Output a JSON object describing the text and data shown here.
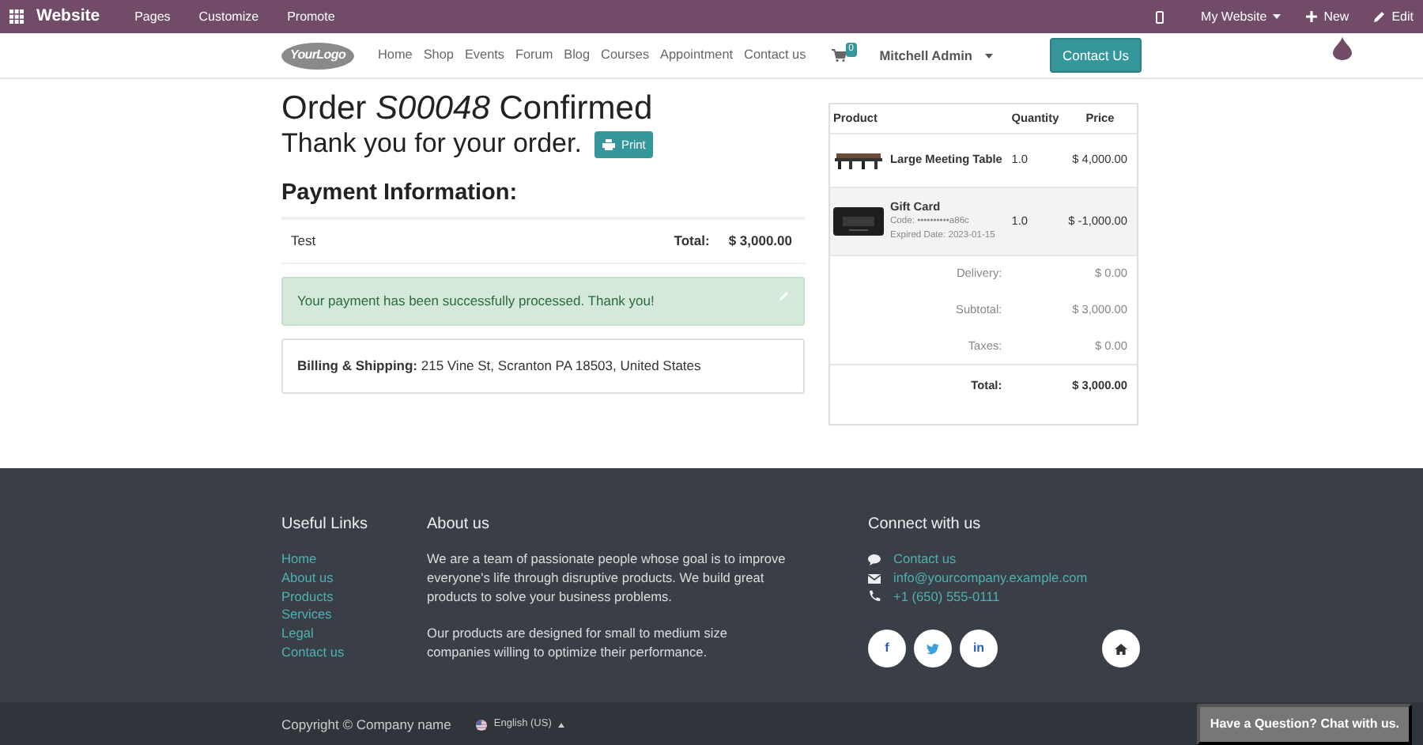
{
  "admin_bar": {
    "title": "Website",
    "menu": [
      "Pages",
      "Customize",
      "Promote"
    ],
    "right": [
      {
        "kind": "mobile"
      },
      {
        "kind": "dropdown",
        "label": "My Website"
      },
      {
        "kind": "new",
        "label": "New"
      },
      {
        "kind": "edit",
        "label": "Edit"
      }
    ]
  },
  "header": {
    "logo": "YourLogo",
    "nav": [
      {
        "label": "Home",
        "selected": false
      },
      {
        "label": "Shop",
        "selected": false
      },
      {
        "label": "Events",
        "selected": false
      },
      {
        "label": "Forum",
        "selected": false
      },
      {
        "label": "Blog",
        "selected": false
      },
      {
        "label": "Courses",
        "selected": false
      },
      {
        "label": "Appointment",
        "selected": false
      },
      {
        "label": "Contact us",
        "selected": false
      }
    ],
    "cart_count": "0",
    "user": "Mitchell Admin",
    "cta": "Contact Us"
  },
  "order": {
    "title": "Order *S00048* Confirmed",
    "thanks": "Thank you for your order.",
    "print": "Print",
    "payment_heading": "Payment Information:",
    "payment": {
      "method": "Test",
      "total_label": "Total:",
      "total": "$ 3,000.00"
    },
    "alert": "Your payment has been successfully processed. Thank you!",
    "billing_label": "Billing & Shipping:",
    "billing": "215 Vine St, Scranton PA 18503, United States"
  },
  "summary": {
    "columns": [
      "Product",
      "Quantity",
      "Price"
    ],
    "lines": [
      {
        "name": "Large Meeting Table",
        "quantity": "1.0",
        "price": "$ 4,000.00",
        "shaded": false
      },
      {
        "name": "Gift Card",
        "quantity": "1.0",
        "price": "$ -1,000.00",
        "details": [
          "Code: ••••••••••a86c",
          "Expired Date: 2023-01-15"
        ],
        "shaded": true
      }
    ],
    "totals": [
      {
        "label": "Delivery:",
        "value": "$ 0.00",
        "bold": false
      },
      {
        "label": "Subtotal:",
        "value": "$ 3,000.00",
        "bold": false
      },
      {
        "label": "Taxes:",
        "value": "$ 0.00",
        "bold": false
      },
      {
        "label": "Total:",
        "value": "$ 3,000.00",
        "bold": true
      }
    ]
  },
  "footer": {
    "links_heading": "Useful Links",
    "links": [
      "Home",
      "About us",
      "Products",
      "Services",
      "Legal",
      "Contact us"
    ],
    "about_heading": "About us",
    "about": [
      "We are a team of passionate people whose goal is to improve everyone's life through disruptive products. We build great products to solve your business problems.",
      "Our products are designed for small to medium size companies willing to optimize their performance."
    ],
    "connect_heading": "Connect with us",
    "contacts": [
      {
        "kind": "chat",
        "label": "Contact us"
      },
      {
        "kind": "mail",
        "label": "info@yourcompany.example.com"
      },
      {
        "kind": "phone",
        "label": "+1 (650) 555-0111"
      }
    ],
    "social": [
      {
        "kind": "facebook",
        "label": "f"
      },
      {
        "kind": "twitter"
      },
      {
        "kind": "linkedin",
        "label": "in"
      }
    ],
    "copyright": "Copyright © Company name",
    "language": "English (US)"
  },
  "chat_button": "Have a Question? Chat with us."
}
